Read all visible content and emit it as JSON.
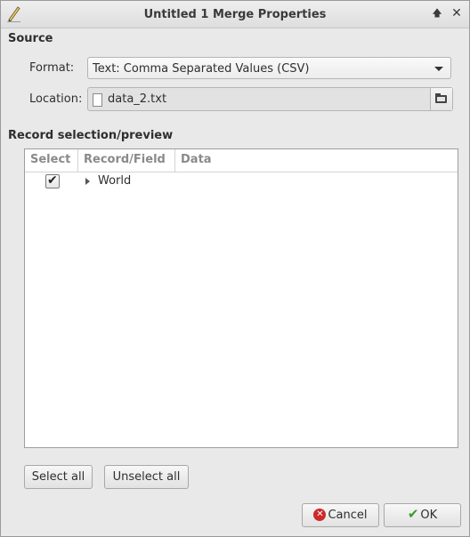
{
  "window": {
    "title": "Untitled 1 Merge Properties",
    "icons": {
      "app": "pen-icon",
      "keep_above": "up-arrow-icon",
      "close": "close-icon"
    }
  },
  "source": {
    "heading": "Source",
    "format_label": "Format:",
    "format_value": "Text: Comma Separated Values (CSV)",
    "location_label": "Location:",
    "location_value": "data_2.txt"
  },
  "records": {
    "heading": "Record selection/preview",
    "columns": [
      "Select",
      "Record/Field",
      "Data"
    ],
    "rows": [
      {
        "checked": true,
        "label": "World",
        "data": ""
      }
    ]
  },
  "buttons": {
    "select_all": "Select all",
    "unselect_all": "Unselect all",
    "cancel": "Cancel",
    "ok": "OK"
  },
  "colors": {
    "cancel_icon": "#cc2a2a",
    "ok_icon": "#3b9b2a"
  }
}
